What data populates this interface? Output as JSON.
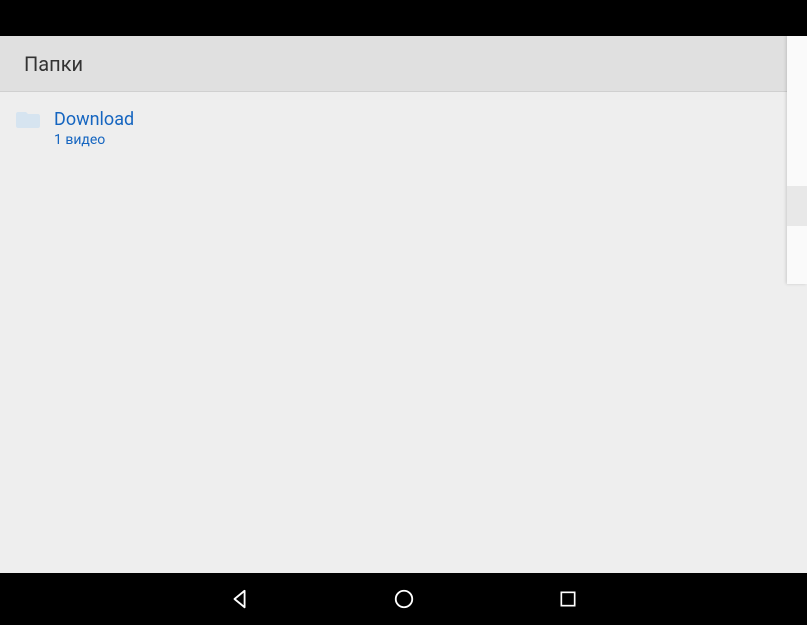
{
  "header": {
    "title": "Папки"
  },
  "folders": [
    {
      "name": "Download",
      "count": "1 видео"
    }
  ]
}
